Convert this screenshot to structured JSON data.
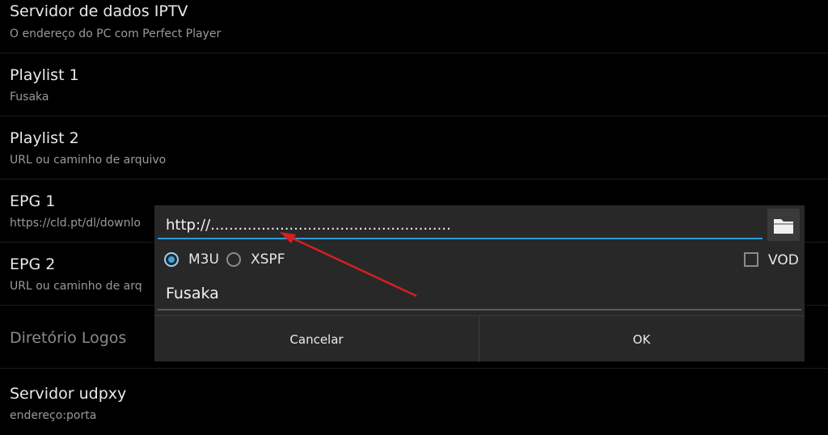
{
  "settings": {
    "items": [
      {
        "title": "Servidor de dados IPTV",
        "subtitle": "O endereço do PC com Perfect Player"
      },
      {
        "title": "Playlist 1",
        "subtitle": "Fusaka"
      },
      {
        "title": "Playlist 2",
        "subtitle": "URL ou caminho de arquivo"
      },
      {
        "title": "EPG 1",
        "subtitle": "https://cld.pt/dl/downlo"
      },
      {
        "title": "EPG 2",
        "subtitle": "URL ou caminho de arq"
      },
      {
        "title": "Diretório Logos",
        "subtitle": ""
      },
      {
        "title": "Servidor udpxy",
        "subtitle": "endereço:porta"
      }
    ]
  },
  "dialog": {
    "url_value": "http://....................................................",
    "format_options": [
      {
        "label": "M3U",
        "selected": true
      },
      {
        "label": "XSPF",
        "selected": false
      }
    ],
    "vod_label": "VOD",
    "vod_checked": false,
    "name_value": "Fusaka",
    "cancel_label": "Cancelar",
    "ok_label": "OK",
    "browse_icon": "folder-icon"
  },
  "colors": {
    "accent": "#33a6e6",
    "annotation_arrow": "#d42020",
    "background": "#000000",
    "dialog_bg": "#282828"
  }
}
